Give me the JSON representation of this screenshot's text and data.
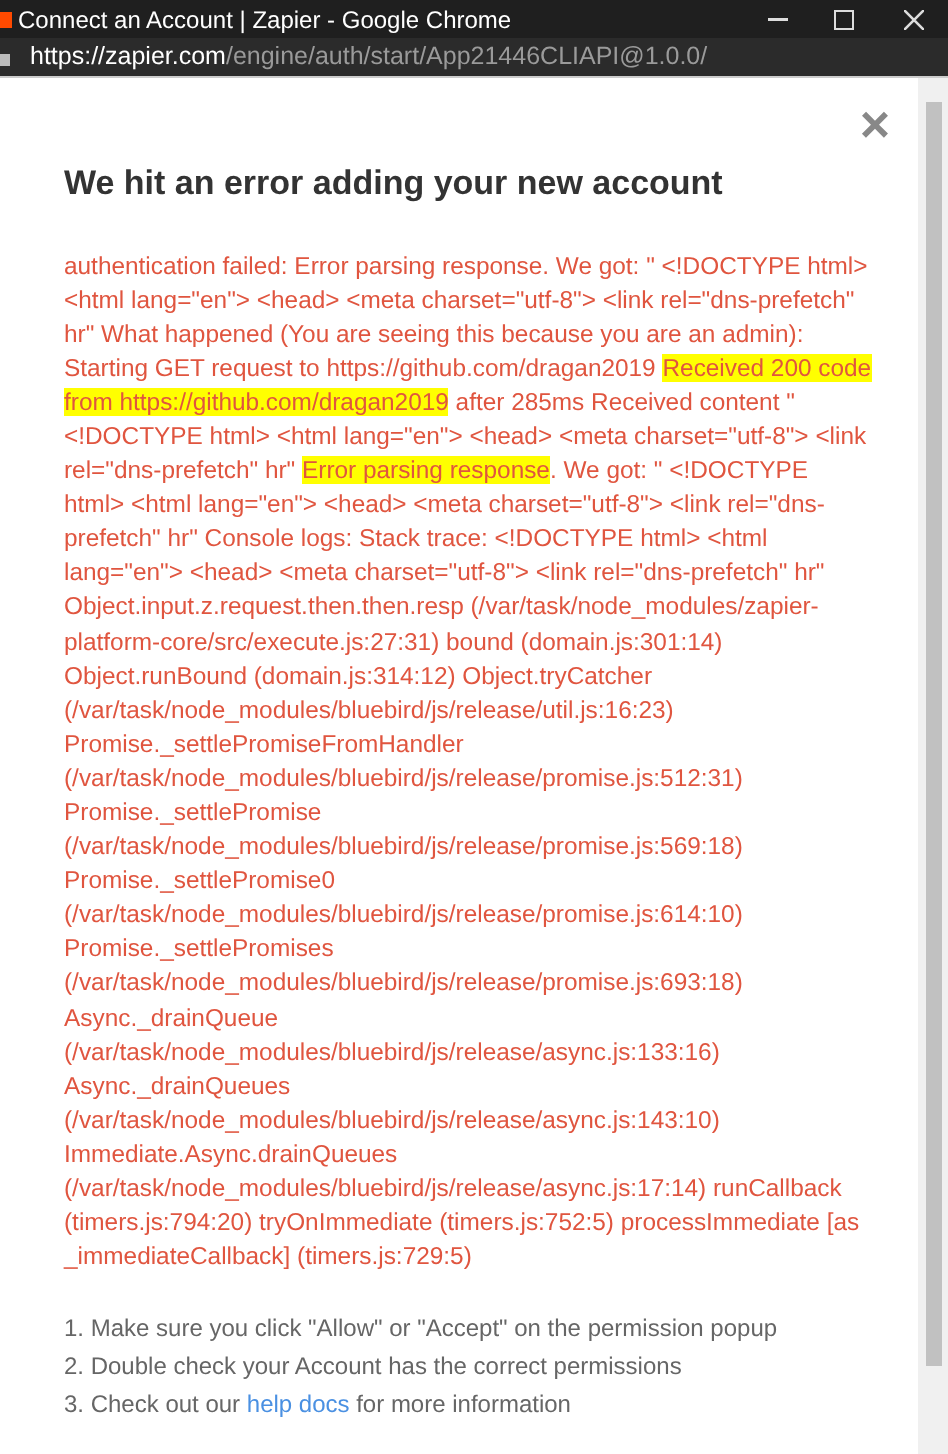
{
  "window": {
    "title": "Connect an Account | Zapier - Google Chrome"
  },
  "address_bar": {
    "host": "https://zapier.com",
    "path": "/engine/auth/start/App21446CLIAPI@1.0.0/"
  },
  "dialog": {
    "close": "×",
    "heading": "We hit an error adding your new account",
    "error": [
      {
        "text": "authentication failed: Error parsing response. We got: \" <!DOCTYPE html> <html lang=\"en\"> <head> <meta charset=\"utf-8\"> <link rel=\"dns-prefetch\" hr\" What happened (You are seeing this because you are an admin): Starting GET request to https://github.com/dragan2019 ",
        "highlighted": false
      },
      {
        "text": "Received 200 code from https://github.com/dragan2019",
        "highlighted": true
      },
      {
        "text": " after 285ms Received content \" <!DOCTYPE html> <html lang=\"en\"> <head> <meta charset=\"utf-8\"> <link rel=\"dns-prefetch\" hr\" ",
        "highlighted": false
      },
      {
        "text": "Error parsing response",
        "highlighted": true
      },
      {
        "text": ". We got: \" <!DOCTYPE html> <html lang=\"en\"> <head> <meta charset=\"utf-8\"> <link rel=\"dns-prefetch\" hr\" Console logs: Stack trace: <!DOCTYPE html> <html lang=\"en\"> <head> <meta charset=\"utf-8\"> <link rel=\"dns-prefetch\" hr\" Object.input.z.request.then.then.resp (/var/task/node_modules/zapier-platform-core/src/execute.js:27:31) bound (domain.js:301:14) Object.runBound (domain.js:314:12) Object.tryCatcher (/var/task/node_modules/bluebird/js/release/util.js:16:23) Promise._settlePromiseFromHandler (/var/task/node_modules/bluebird/js/release/promise.js:512:31) Promise._settlePromise (/var/task/node_modules/bluebird/js/release/promise.js:569:18) Promise._settlePromise0 (/var/task/node_modules/bluebird/js/release/promise.js:614:10) Promise._settlePromises (/var/task/node_modules/bluebird/js/release/promise.js:693:18) Async._drainQueue (/var/task/node_modules/bluebird/js/release/async.js:133:16) Async._drainQueues (/var/task/node_modules/bluebird/js/release/async.js:143:10) Immediate.Async.drainQueues (/var/task/node_modules/bluebird/js/release/async.js:17:14) runCallback (timers.js:794:20) tryOnImmediate (timers.js:752:5) processImmediate [as _immediateCallback] (timers.js:729:5)",
        "highlighted": false
      }
    ],
    "steps": [
      {
        "text": "1. Make sure you click \"Allow\" or \"Accept\" on the permission popup"
      },
      {
        "text": "2. Double check your Account has the correct permissions"
      },
      {
        "text": "3. Check out our ",
        "link": "help docs",
        "after": " for more information"
      }
    ]
  }
}
